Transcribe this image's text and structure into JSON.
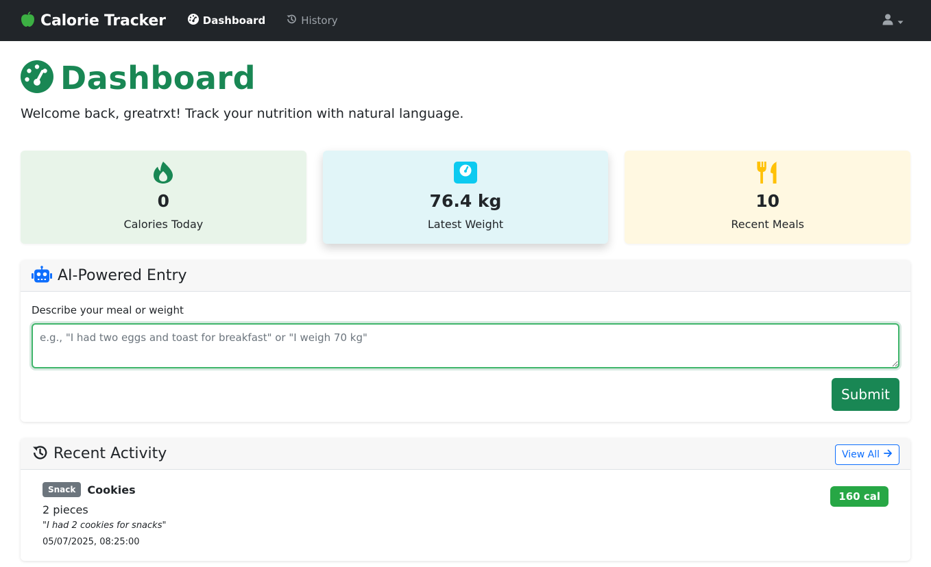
{
  "app": {
    "brand": "Calorie Tracker",
    "nav": {
      "dashboard": "Dashboard",
      "history": "History"
    }
  },
  "page": {
    "title": "Dashboard",
    "welcome": "Welcome back, greatrxt! Track your nutrition with natural language."
  },
  "stats": [
    {
      "value": "0",
      "label": "Calories Today",
      "icon": "fire-icon",
      "color": "#198754"
    },
    {
      "value": "76.4 kg",
      "label": "Latest Weight",
      "icon": "weight-scale-icon",
      "color": "#0dcaf0"
    },
    {
      "value": "10",
      "label": "Recent Meals",
      "icon": "utensils-icon",
      "color": "#ffc107"
    }
  ],
  "entry": {
    "title": "AI-Powered Entry",
    "label": "Describe your meal or weight",
    "value": "",
    "placeholder": "e.g., \"I had two eggs and toast for breakfast\" or \"I weigh 70 kg\"",
    "submit": "Submit"
  },
  "activity": {
    "title": "Recent Activity",
    "view_all": "View All",
    "items": [
      {
        "type": "Snack",
        "name": "Cookies",
        "quantity": "2 pieces",
        "quote": "\"I had 2 cookies for snacks\"",
        "timestamp": "05/07/2025, 08:25:00",
        "calories": "160 cal"
      }
    ]
  },
  "colors": {
    "primary": "#198754",
    "link": "#0d6efd",
    "navbar": "#212529"
  }
}
